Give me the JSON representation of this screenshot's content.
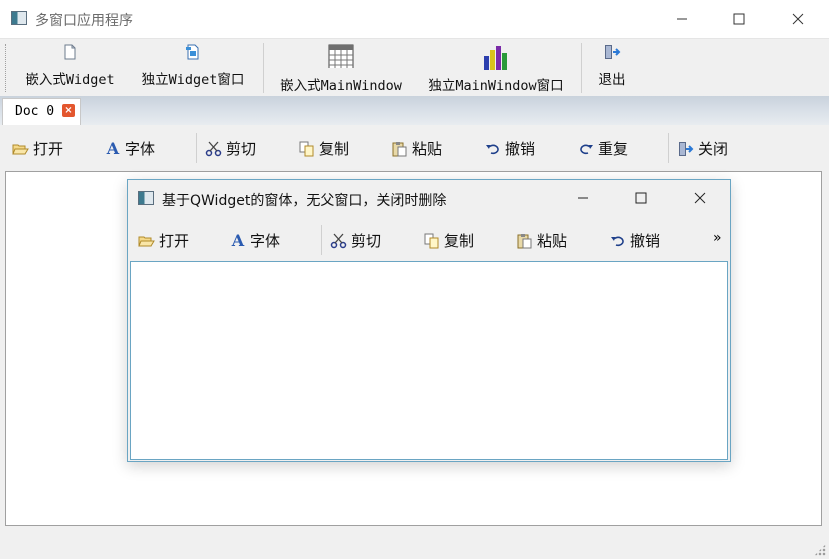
{
  "window": {
    "title": "多窗口应用程序"
  },
  "main_toolbar": {
    "items": [
      {
        "label": "嵌入式Widget",
        "icon": "document-icon"
      },
      {
        "label": "独立Widget窗口",
        "icon": "document-blue-icon"
      },
      {
        "label": "嵌入式MainWindow",
        "icon": "grid-table-icon"
      },
      {
        "label": "独立MainWindow窗口",
        "icon": "bar-chart-icon"
      },
      {
        "label": "退出",
        "icon": "exit-door-icon"
      }
    ]
  },
  "tabs": [
    {
      "label": "Doc 0",
      "close": "×"
    }
  ],
  "edit_toolbar": {
    "items": [
      {
        "label": "打开",
        "icon": "folder-open-icon"
      },
      {
        "label": "字体",
        "icon": "font-icon"
      },
      {
        "label": "剪切",
        "icon": "scissors-icon"
      },
      {
        "label": "复制",
        "icon": "copy-icon"
      },
      {
        "label": "粘贴",
        "icon": "paste-icon"
      },
      {
        "label": "撤销",
        "icon": "undo-icon"
      },
      {
        "label": "重复",
        "icon": "redo-icon"
      },
      {
        "label": "关闭",
        "icon": "close-door-icon"
      }
    ]
  },
  "sub_window": {
    "title": "基于QWidget的窗体，无父窗口，关闭时删除",
    "toolbar": [
      {
        "label": "打开",
        "icon": "folder-open-icon"
      },
      {
        "label": "字体",
        "icon": "font-icon"
      },
      {
        "label": "剪切",
        "icon": "scissors-icon"
      },
      {
        "label": "复制",
        "icon": "copy-icon"
      },
      {
        "label": "粘贴",
        "icon": "paste-icon"
      },
      {
        "label": "撤销",
        "icon": "undo-icon"
      }
    ],
    "overflow": "»"
  }
}
